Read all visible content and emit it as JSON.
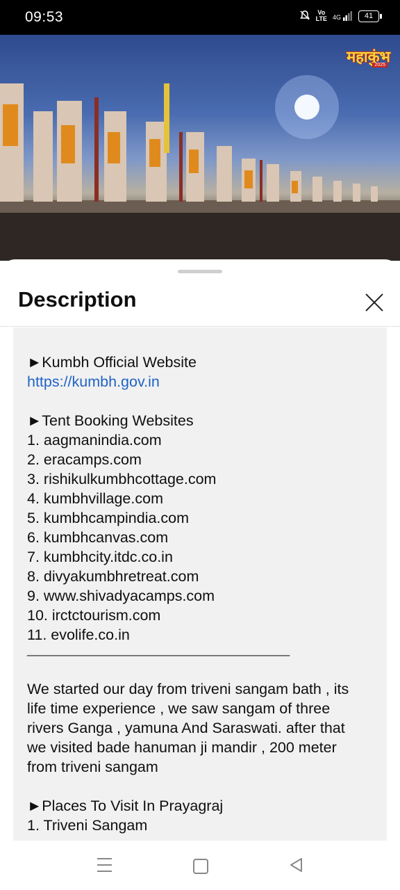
{
  "status_bar": {
    "time": "09:53",
    "icons": [
      "mute-bell-icon",
      "volte-icon",
      "4g-signal-icon"
    ],
    "vo_label": "Vo",
    "lte_label": "LTE",
    "network": "4G",
    "battery": "41"
  },
  "video": {
    "logo_text": "महाकुंभ",
    "logo_year": "2025"
  },
  "sheet": {
    "title": "Description",
    "official_header": "►Kumbh Official Website",
    "official_link": "https://kumbh.gov.in",
    "tent_header": "►Tent Booking Websites",
    "tent_sites": [
      "1. aagmanindia.com",
      "2. eracamps.com",
      "3. rishikulkumbhcottage.com",
      "4. kumbhvillage.com",
      "5. kumbhcampindia.com",
      "6. kumbhcanvas.com",
      "7. kumbhcity.itdc.co.in",
      "8. divyakumbhretreat.com",
      "9. www.shivadyacamps.com",
      "10. irctctourism.com",
      "11. evolife.co.in"
    ],
    "rule": "________________________________________",
    "paragraph": "We started our day from triveni sangam bath , its life time experience , we saw sangam of three rivers Ganga , yamuna And Saraswati. after that we visited bade hanuman ji mandir , 200 meter from triveni sangam",
    "places_header": "►Places To Visit In Prayagraj",
    "places": [
      "1. Triveni Sangam"
    ]
  },
  "navbar": {
    "icons": [
      "menu-icon",
      "home-icon",
      "back-icon"
    ]
  }
}
